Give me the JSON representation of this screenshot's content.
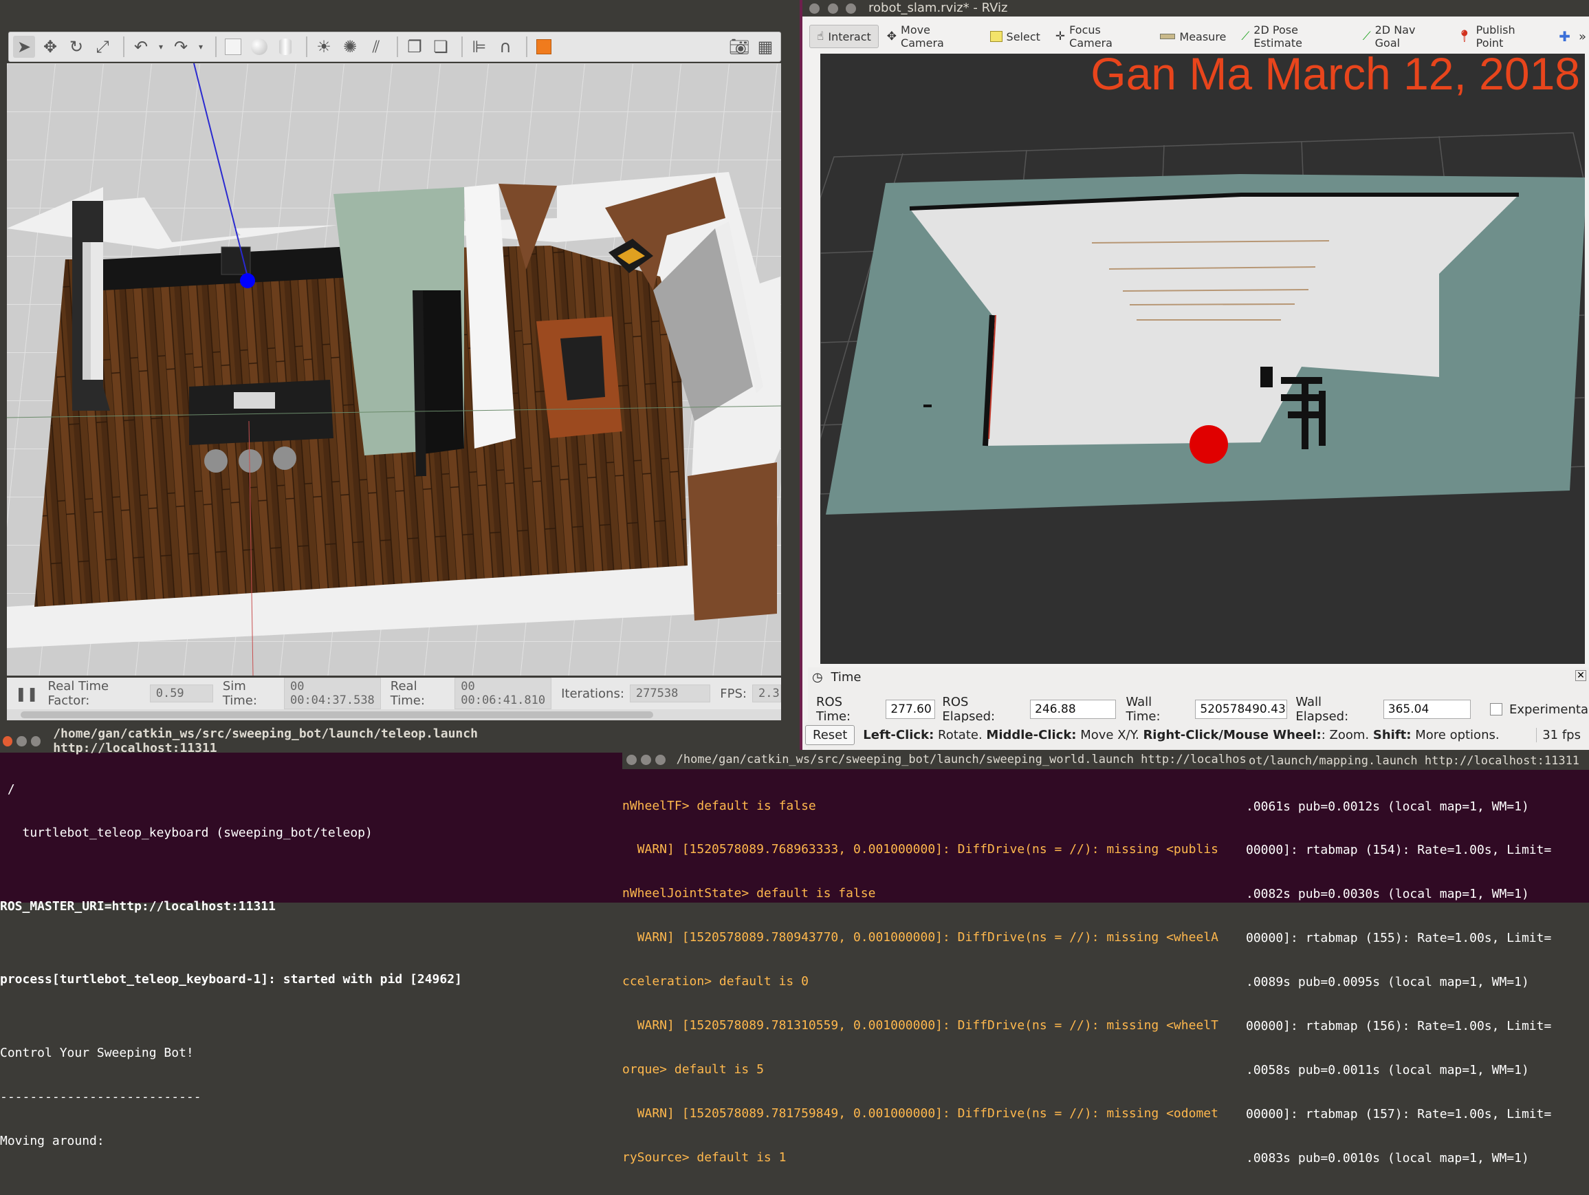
{
  "gazebo": {
    "toolbar_icons": [
      "pointer-icon",
      "move-icon",
      "rotate-icon",
      "scale-icon",
      "undo-icon",
      "redo-icon",
      "box-icon",
      "sphere-icon",
      "cylinder-icon",
      "pointlight-icon",
      "spotlight-icon",
      "directionallight-icon",
      "copy-icon",
      "paste-icon",
      "align-icon",
      "snap-icon",
      "orange-box-icon",
      "camera-icon",
      "record-icon"
    ],
    "status": {
      "real_time_factor_label": "Real Time Factor:",
      "real_time_factor": "0.59",
      "sim_time_label": "Sim Time:",
      "sim_time": "00 00:04:37.538",
      "real_time_label": "Real Time:",
      "real_time": "00 00:06:41.810",
      "iterations_label": "Iterations:",
      "iterations": "277538",
      "fps_label": "FPS:",
      "fps": "2.3"
    }
  },
  "rviz": {
    "title": "robot_slam.rviz* - RViz",
    "tools": [
      {
        "label": "Interact",
        "icon": "hand-icon"
      },
      {
        "label": "Move Camera",
        "icon": "move-camera-icon"
      },
      {
        "label": "Select",
        "icon": "select-icon"
      },
      {
        "label": "Focus Camera",
        "icon": "focus-icon"
      },
      {
        "label": "Measure",
        "icon": "measure-icon"
      },
      {
        "label": "2D Pose Estimate",
        "icon": "green-arrow-icon"
      },
      {
        "label": "2D Nav Goal",
        "icon": "green-arrow-icon"
      },
      {
        "label": "Publish Point",
        "icon": "pin-icon"
      }
    ],
    "overlay_text": "Gan Ma March 12, 2018",
    "overlay_color": "#e8451c",
    "time_panel": {
      "title": "Time",
      "ros_time_label": "ROS Time:",
      "ros_time": "277.60",
      "ros_elapsed_label": "ROS Elapsed:",
      "ros_elapsed": "246.88",
      "wall_time_label": "Wall Time:",
      "wall_time": "520578490.43",
      "wall_elapsed_label": "Wall Elapsed:",
      "wall_elapsed": "365.04",
      "experimental_label": "Experimental",
      "reset_label": "Reset",
      "hint_left_click": "Left-Click:",
      "hint_left_click_desc": "Rotate.",
      "hint_middle_click": "Middle-Click:",
      "hint_middle_click_desc": "Move X/Y.",
      "hint_right_click": "Right-Click/Mouse Wheel:",
      "hint_right_click_desc": ": Zoom.",
      "hint_shift": "Shift:",
      "hint_shift_desc": "More options.",
      "fps": "31 fps"
    }
  },
  "terminals": [
    {
      "title": "/home/gan/catkin_ws/src/sweeping_bot/launch/teleop.launch http://localhost:11311",
      "lines": [
        " /",
        "   turtlebot_teleop_keyboard (sweeping_bot/teleop)",
        "",
        "ROS_MASTER_URI=http://localhost:11311",
        "",
        "process[turtlebot_teleop_keyboard-1]: started with pid [24962]",
        "",
        "Control Your Sweeping Bot!",
        "---------------------------",
        "Moving around:"
      ]
    },
    {
      "title": "/home/gan/catkin_ws/src/sweeping_bot/launch/sweeping_world.launch http://localhost",
      "lines": [
        "nWheelTF> default is false",
        "  WARN] [1520578089.768963333, 0.001000000]: DiffDrive(ns = //): missing <publis",
        "nWheelJointState> default is false",
        "  WARN] [1520578089.780943770, 0.001000000]: DiffDrive(ns = //): missing <wheelA",
        "cceleration> default is 0",
        "  WARN] [1520578089.781310559, 0.001000000]: DiffDrive(ns = //): missing <wheelT",
        "orque> default is 5",
        "  WARN] [1520578089.781759849, 0.001000000]: DiffDrive(ns = //): missing <odomet",
        "rySource> default is 1"
      ]
    },
    {
      "title": "ot/launch/mapping.launch http://localhost:11311",
      "lines": [
        ".0061s pub=0.0012s (local map=1, WM=1)",
        "00000]: rtabmap (154): Rate=1.00s, Limit=",
        ".0082s pub=0.0030s (local map=1, WM=1)",
        "00000]: rtabmap (155): Rate=1.00s, Limit=",
        ".0089s pub=0.0095s (local map=1, WM=1)",
        "00000]: rtabmap (156): Rate=1.00s, Limit=",
        ".0058s pub=0.0011s (local map=1, WM=1)",
        "00000]: rtabmap (157): Rate=1.00s, Limit=",
        ".0083s pub=0.0010s (local map=1, WM=1)"
      ]
    }
  ]
}
